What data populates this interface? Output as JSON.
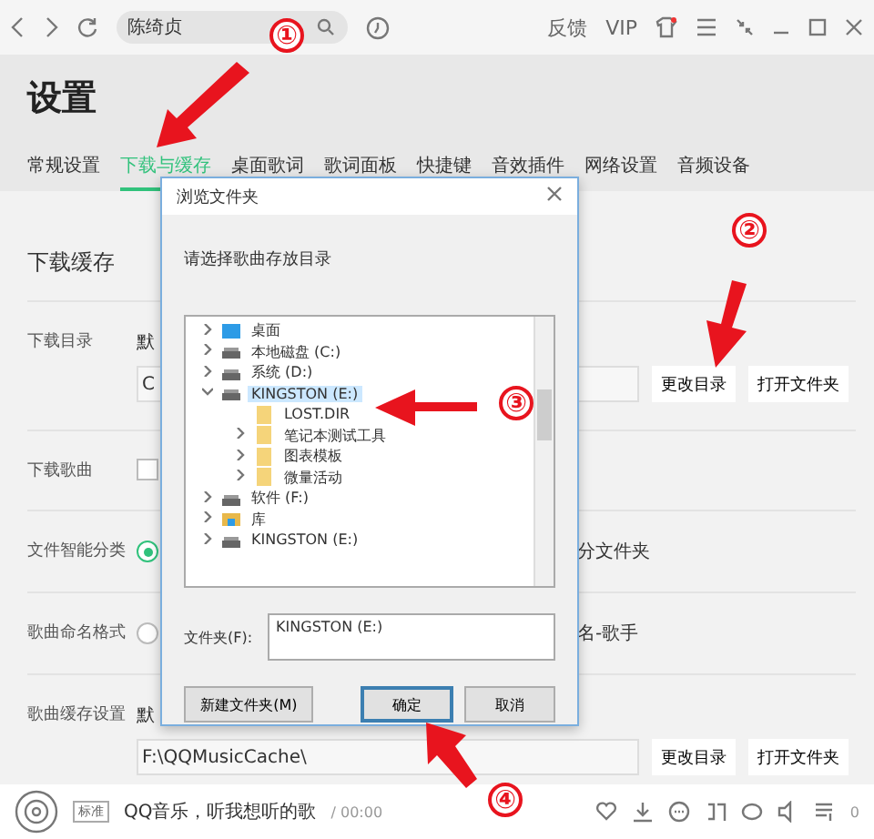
{
  "topbar": {
    "search": {
      "value": "陈绮贞"
    },
    "links": [
      "反馈",
      "VIP"
    ]
  },
  "page": {
    "title": "设置",
    "tabs": [
      {
        "label": "常规设置",
        "selected": false
      },
      {
        "label": "下载与缓存",
        "selected": true
      },
      {
        "label": "桌面歌词",
        "selected": false
      },
      {
        "label": "歌词面板",
        "selected": false
      },
      {
        "label": "快捷键",
        "selected": false
      },
      {
        "label": "音效插件",
        "selected": false
      },
      {
        "label": "网络设置",
        "selected": false
      },
      {
        "label": "音频设备",
        "selected": false
      }
    ],
    "section": "下载缓存",
    "rows": [
      {
        "kind": "path",
        "label": "下载目录",
        "note": "默",
        "path": "C",
        "buttons": [
          "更改目录",
          "打开文件夹"
        ]
      },
      {
        "kind": "checkbox",
        "label": "下载歌曲",
        "checked": false
      },
      {
        "kind": "radio",
        "label": "文件智能分类",
        "selected": true,
        "text": "分文件夹"
      },
      {
        "kind": "radio",
        "label": "歌曲命名格式",
        "selected": false,
        "text": "名-歌手"
      },
      {
        "kind": "path",
        "label": "歌曲缓存设置",
        "note": "默",
        "path": "F:\\QQMusicCache\\",
        "buttons": [
          "更改目录",
          "打开文件夹"
        ]
      }
    ]
  },
  "player": {
    "quality": "标准",
    "song": "QQ音乐，听我想听的歌",
    "time": "/ 00:00",
    "playlist_count": "0"
  },
  "dialog": {
    "title": "浏览文件夹",
    "prompt": "请选择歌曲存放目录",
    "tree": [
      {
        "kind": "desktop",
        "label": "桌面",
        "expanded": false,
        "selected": false
      },
      {
        "kind": "drive",
        "label": "本地磁盘 (C:)",
        "expanded": false,
        "selected": false
      },
      {
        "kind": "drive",
        "label": "系统 (D:)",
        "expanded": false,
        "selected": false
      },
      {
        "kind": "drive",
        "label": "KINGSTON (E:)",
        "expanded": true,
        "selected": true,
        "children": [
          {
            "kind": "folder",
            "label": "LOST.DIR",
            "selected": false
          },
          {
            "kind": "folder",
            "label": "笔记本测试工具",
            "expanded": false,
            "selected": false
          },
          {
            "kind": "folder",
            "label": "图表模板",
            "expanded": false,
            "selected": false
          },
          {
            "kind": "folder",
            "label": "微量活动",
            "expanded": false,
            "selected": false
          }
        ]
      },
      {
        "kind": "drive",
        "label": "软件 (F:)",
        "expanded": false,
        "selected": false
      },
      {
        "kind": "library",
        "label": "库",
        "expanded": false,
        "selected": false
      },
      {
        "kind": "drive",
        "label": "KINGSTON (E:)",
        "expanded": false,
        "selected": false
      }
    ],
    "folder_label": "文件夹(F):",
    "folder_value": "KINGSTON (E:)",
    "buttons": [
      {
        "label": "新建文件夹(M)",
        "kind": "new"
      },
      {
        "label": "确定",
        "kind": "ok"
      },
      {
        "label": "取消",
        "kind": "cancel"
      }
    ]
  },
  "annotations": [
    {
      "label": "①"
    },
    {
      "label": "②"
    },
    {
      "label": "③"
    },
    {
      "label": "④"
    }
  ]
}
